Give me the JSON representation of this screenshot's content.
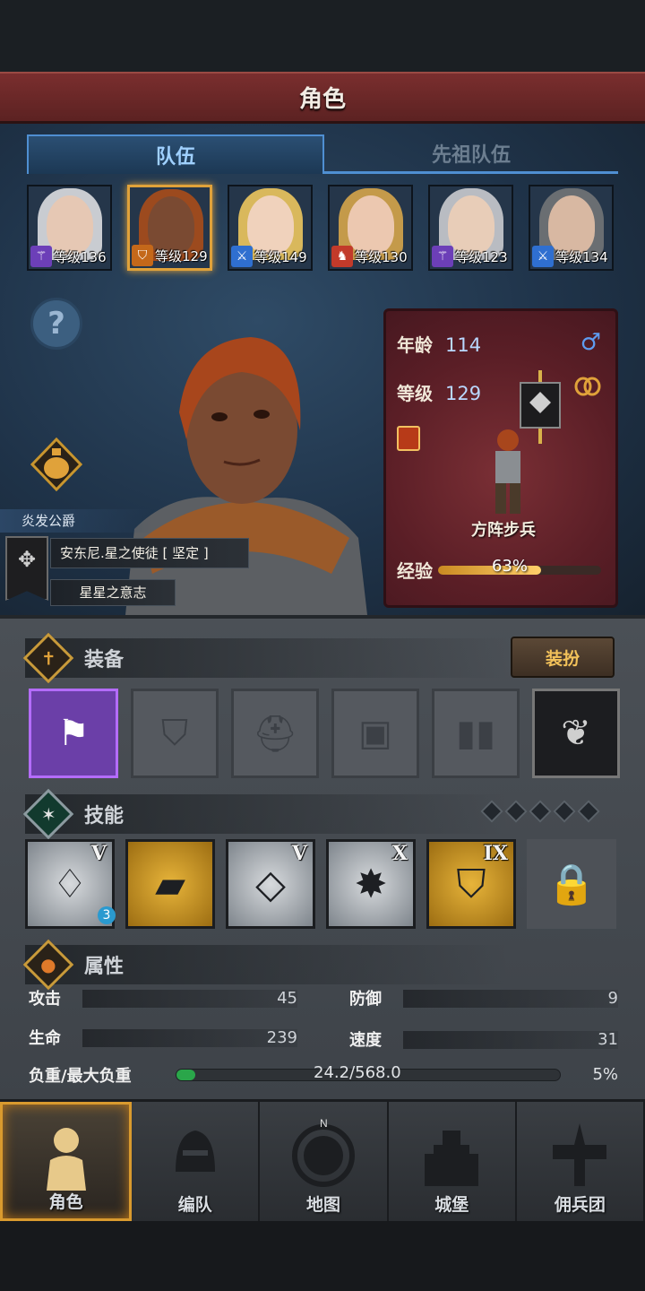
{
  "header": {
    "title": "角色"
  },
  "tabs": [
    {
      "label": "队伍",
      "active": true
    },
    {
      "label": "先祖队伍",
      "active": false
    }
  ],
  "roster": [
    {
      "level_text": "等级136",
      "class_icon": "staff-icon",
      "selected": false
    },
    {
      "level_text": "等级129",
      "class_icon": "shield-icon",
      "selected": true
    },
    {
      "level_text": "等级149",
      "class_icon": "sword-icon",
      "selected": false
    },
    {
      "level_text": "等级130",
      "class_icon": "horse-icon",
      "selected": false
    },
    {
      "level_text": "等级123",
      "class_icon": "staff-icon",
      "selected": false
    },
    {
      "level_text": "等级134",
      "class_icon": "sword-icon",
      "selected": false
    }
  ],
  "hero": {
    "title": "炎发公爵",
    "name": "安东尼.星之使徒 [ 坚定 ]",
    "will": "星星之意志"
  },
  "info_card": {
    "age_label": "年龄",
    "age": "114",
    "level_label": "等级",
    "level": "129",
    "gender_icon": "♂",
    "unit_name": "方阵步兵",
    "xp_label": "经验",
    "xp_text": "63%",
    "xp_fraction": 0.63
  },
  "equipment": {
    "title": "装备",
    "dress_button": "装扮",
    "slots": [
      "banner-icon",
      "shield-icon",
      "helmet-icon",
      "armor-icon",
      "boots-icon",
      "cape-icon"
    ]
  },
  "skills": {
    "title": "技能",
    "pips": 5,
    "items": [
      {
        "rank": "V",
        "style": "grey",
        "badge": "3"
      },
      {
        "rank": "",
        "style": "gold",
        "badge": ""
      },
      {
        "rank": "V",
        "style": "grey",
        "badge": ""
      },
      {
        "rank": "X",
        "style": "grey",
        "badge": ""
      },
      {
        "rank": "IX",
        "style": "gold",
        "badge": ""
      },
      {
        "rank": "",
        "style": "locked",
        "badge": ""
      }
    ]
  },
  "attributes": {
    "title": "属性",
    "attack_label": "攻击",
    "attack": "45",
    "defense_label": "防御",
    "defense": "9",
    "hp_label": "生命",
    "hp": "239",
    "speed_label": "速度",
    "speed": "31",
    "load_label": "负重/最大负重",
    "load": "24.2/568.0",
    "load_pct": "5%",
    "load_fraction": 0.05
  },
  "nav": [
    {
      "label": "角色",
      "active": true,
      "icon": "knight-icon"
    },
    {
      "label": "编队",
      "active": false,
      "icon": "helmet-icon"
    },
    {
      "label": "地图",
      "active": false,
      "icon": "compass-icon"
    },
    {
      "label": "城堡",
      "active": false,
      "icon": "castle-icon"
    },
    {
      "label": "佣兵团",
      "active": false,
      "icon": "mercenary-icon"
    }
  ],
  "colors": {
    "accent": "#e0a23a",
    "title_red": "#7a2e2e",
    "tab_blue": "#4f8fd2",
    "xp_gold": "#ffd06a",
    "load_green": "#2aa64a"
  }
}
